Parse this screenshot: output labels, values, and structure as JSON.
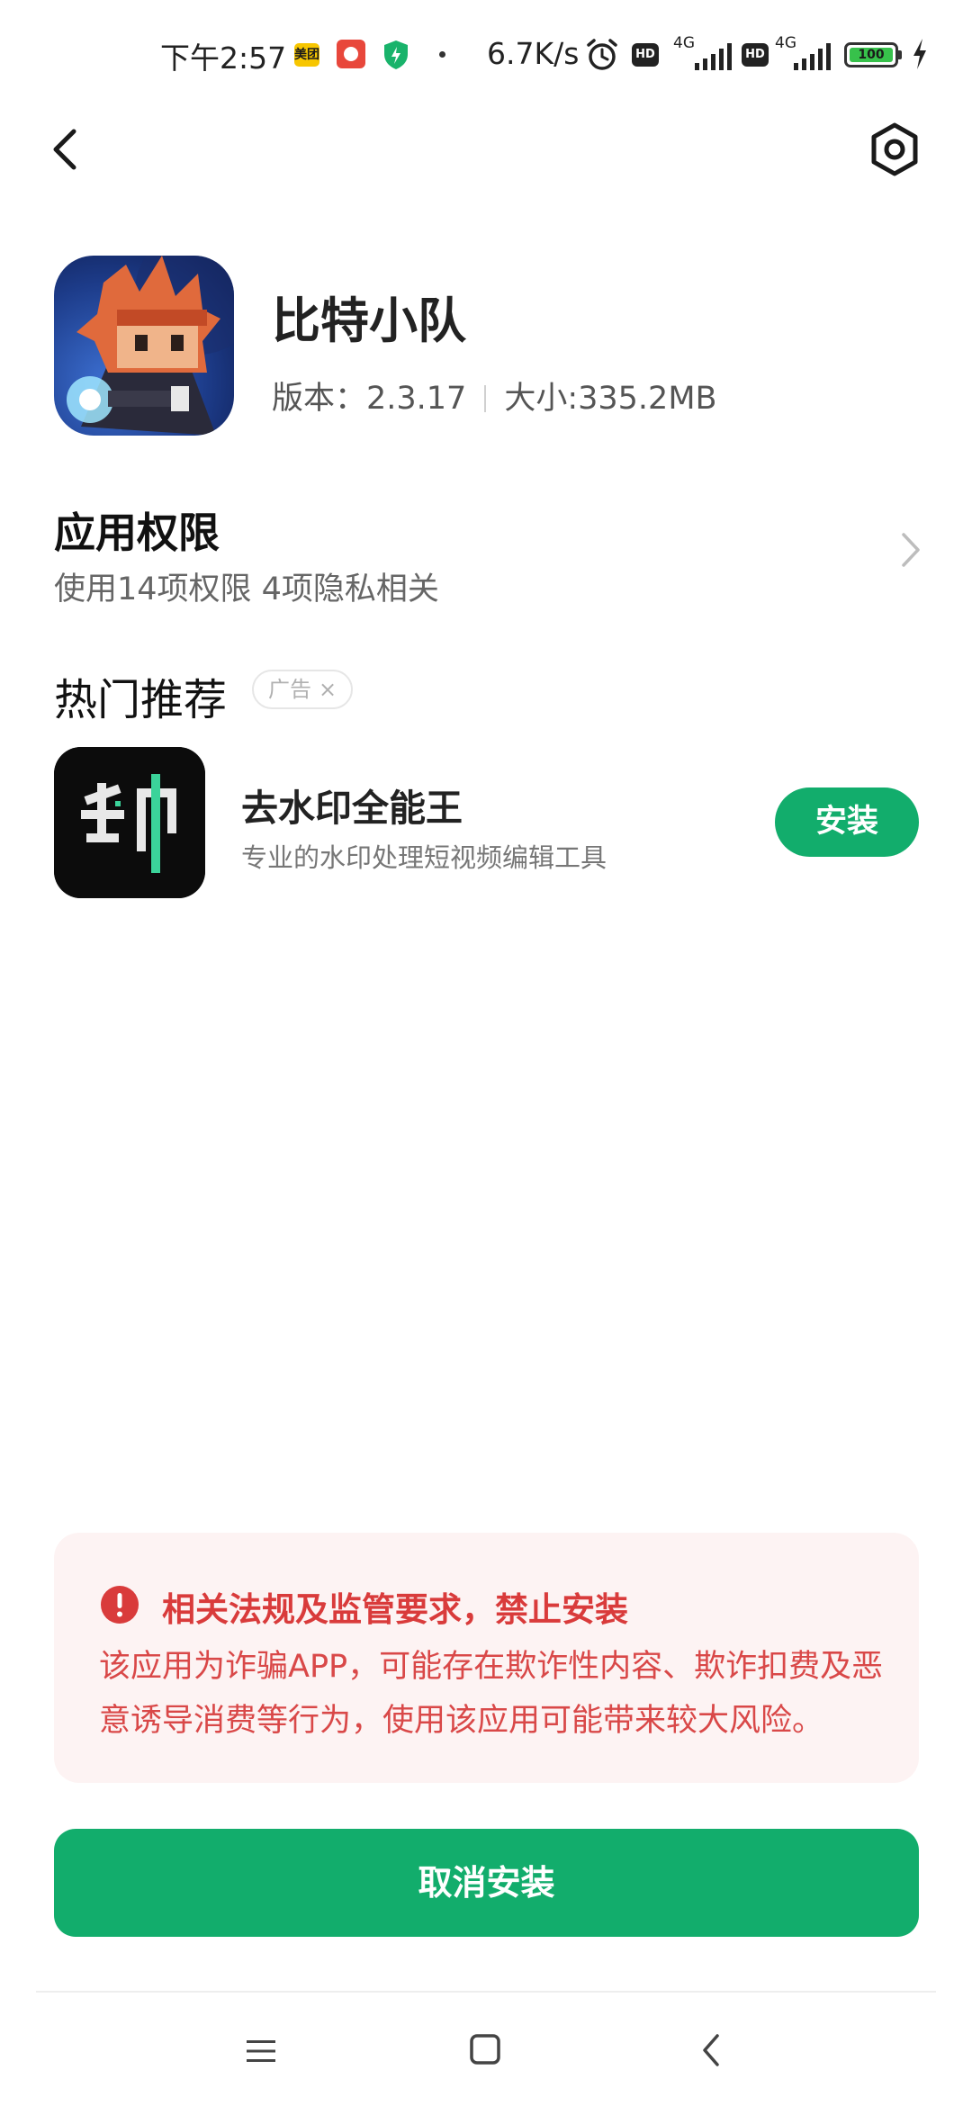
{
  "status_bar": {
    "time": "下午2:57",
    "notif_meituan_label": "美团",
    "net_speed": "6.7K/s",
    "hd_label": "HD",
    "network_1": "4G",
    "network_2": "4G",
    "battery": "100",
    "icons": [
      "meituan-icon",
      "red-app-icon",
      "shield-icon",
      "alarm-icon",
      "signal-icon",
      "battery-icon",
      "charging-icon"
    ]
  },
  "nav": {
    "back_icon": "chevron-left-icon",
    "settings_icon": "hexagon-settings-icon"
  },
  "app": {
    "name": "比特小队",
    "version": "版本：2.3.17",
    "size": "大小:335.2MB"
  },
  "permissions": {
    "title": "应用权限",
    "subtitle": "使用14项权限 4项隐私相关"
  },
  "recommend": {
    "title": "热门推荐",
    "ad_label": "广告",
    "ad_close": "×",
    "items": [
      {
        "name": "去水印全能王",
        "description": "专业的水印处理短视频编辑工具",
        "button": "安装"
      }
    ]
  },
  "warning": {
    "title": "相关法规及监管要求，禁止安装",
    "body": "该应用为诈骗APP，可能存在欺诈性内容、欺诈扣费及恶意诱导消费等行为，使用该应用可能带来较大风险。"
  },
  "actions": {
    "cancel": "取消安装"
  },
  "colors": {
    "primary_green": "#12ad6c",
    "warning_red": "#d93b3b",
    "warning_bg": "#fdf3f3"
  }
}
